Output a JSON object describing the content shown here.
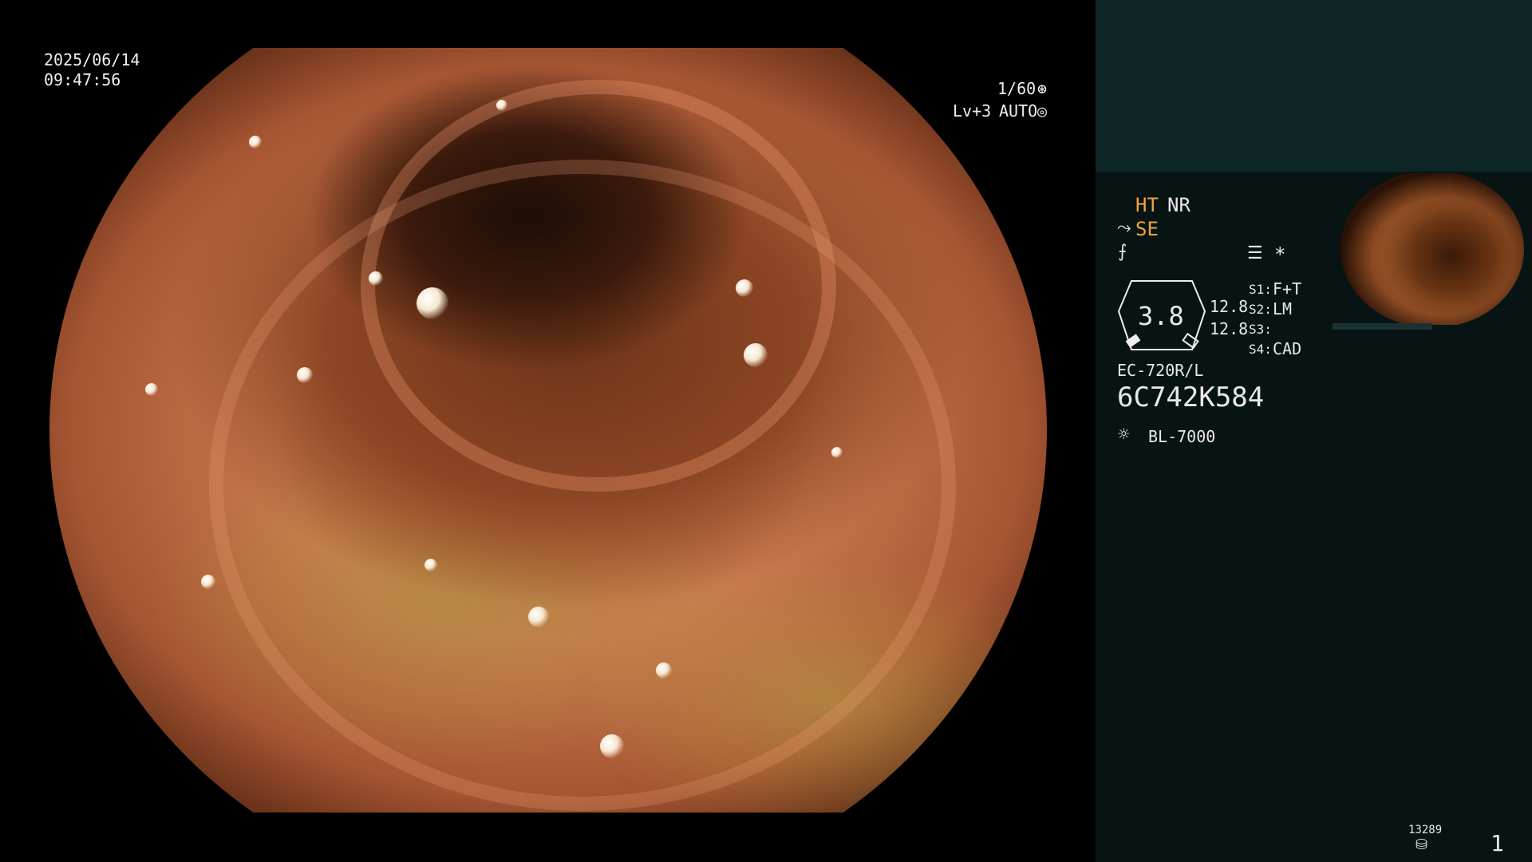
{
  "overlay": {
    "date": "2025/06/14",
    "time": "09:47:56",
    "shutter": "1/60",
    "level": "Lv+3",
    "mode": "AUTO"
  },
  "panel": {
    "ht": "HT",
    "nr": "NR",
    "se": "SE",
    "zoom_value": "3.8",
    "zoom_upper": "12.8",
    "zoom_lower": "12.8",
    "s1_key": "S1:",
    "s1_val": "F+T",
    "s2_key": "S2:",
    "s2_val": "LM",
    "s3_key": "S3:",
    "s3_val": "",
    "s4_key": "S4:",
    "s4_val": "CAD",
    "scope_model": "EC-720R/L",
    "scope_serial": "6C742K584",
    "light_source": "BL-7000",
    "storage_count": "13289",
    "page_number": "1",
    "asterisk": "*"
  },
  "icons": [
    "shutter-icon",
    "auto-icon",
    "scope-bend-icon",
    "focus-icon",
    "menu-icon",
    "light-icon",
    "storage-icon"
  ]
}
